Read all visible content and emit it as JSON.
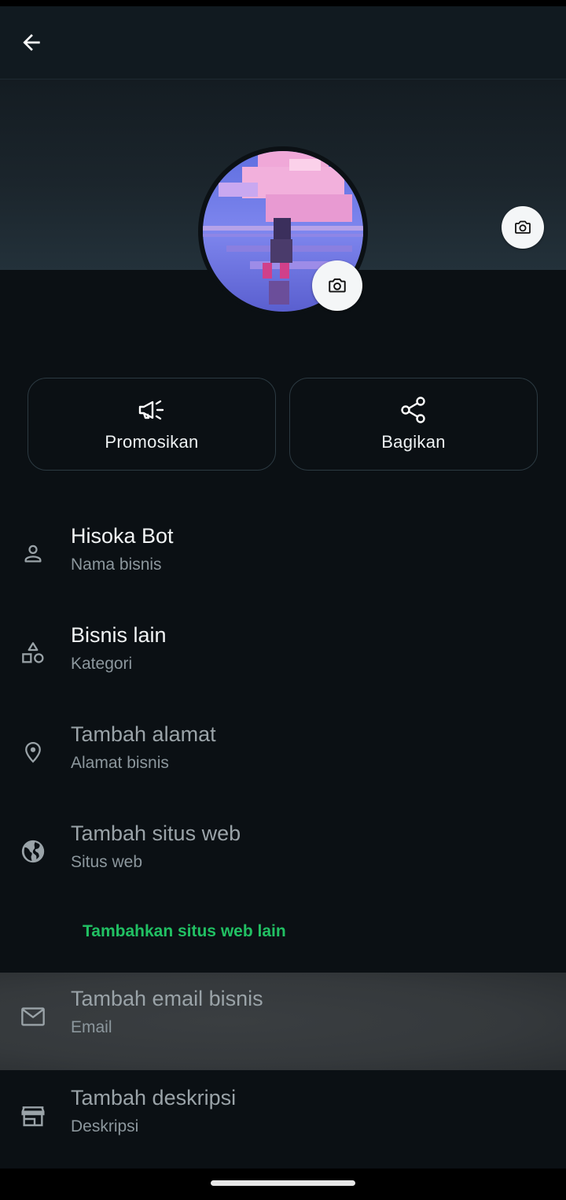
{
  "header": {
    "back_icon": "arrow-left-icon"
  },
  "cover": {
    "camera_icon": "camera-icon"
  },
  "avatar": {
    "camera_icon": "camera-icon"
  },
  "actions": [
    {
      "label": "Promosikan",
      "icon": "megaphone-icon"
    },
    {
      "label": "Bagikan",
      "icon": "share-icon"
    }
  ],
  "fields": [
    {
      "title": "Hisoka Bot",
      "subtitle": "Nama bisnis",
      "icon": "person-icon"
    },
    {
      "title": "Bisnis lain",
      "subtitle": "Kategori",
      "icon": "shapes-icon"
    },
    {
      "title": "Tambah alamat",
      "subtitle": "Alamat bisnis",
      "icon": "location-pin-icon"
    },
    {
      "title": "Tambah situs web",
      "subtitle": "Situs web",
      "icon": "globe-icon"
    },
    {
      "title": "Tambah email bisnis",
      "subtitle": "Email",
      "icon": "mail-icon"
    },
    {
      "title": "Tambah deskripsi",
      "subtitle": "Deskripsi",
      "icon": "store-icon"
    }
  ],
  "add_website_link": "Tambahkan situs web lain",
  "colors": {
    "background": "#0b1014",
    "accent_green": "#21c063",
    "muted_text": "#8c979d"
  }
}
